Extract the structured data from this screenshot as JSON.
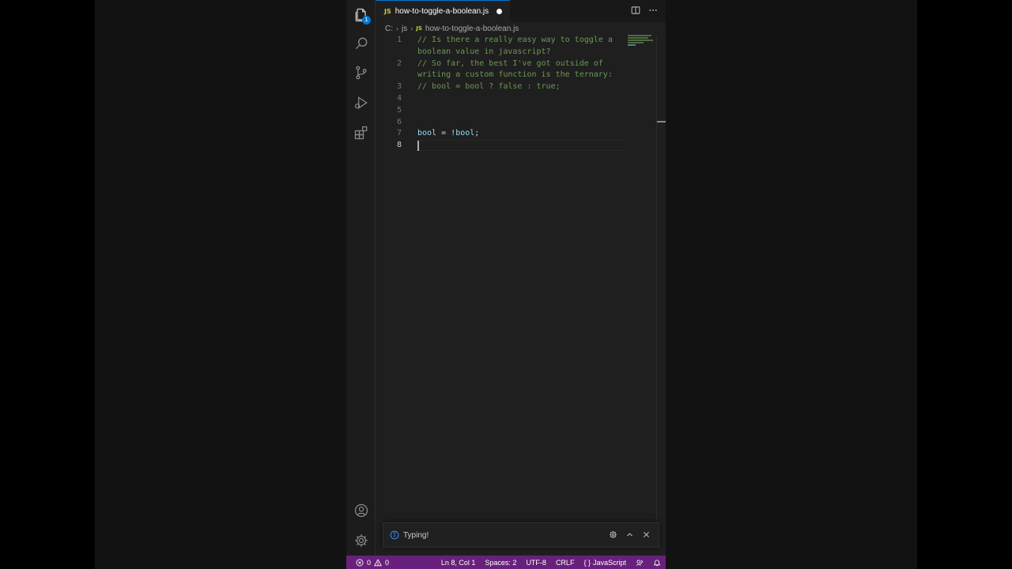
{
  "tab": {
    "language_badge": "JS",
    "title": "how-to-toggle-a-boolean.js"
  },
  "breadcrumb": {
    "drive": "C:",
    "folder": "js",
    "language_badge": "JS",
    "file": "how-to-toggle-a-boolean.js"
  },
  "activity_bar": {
    "explorer_badge": "1",
    "icons": [
      "files-icon",
      "search-icon",
      "source-control-icon",
      "run-debug-icon",
      "extensions-icon",
      "account-icon",
      "settings-gear-icon"
    ]
  },
  "editor": {
    "lines": [
      {
        "number": "1",
        "parts": [
          {
            "text": "// Is there a really easy way to toggle a",
            "class": "comment"
          }
        ]
      },
      {
        "number": "",
        "parts": [
          {
            "text": "boolean value in javascript?",
            "class": "comment"
          }
        ]
      },
      {
        "number": "2",
        "parts": [
          {
            "text": "// So far, the best I've got outside of",
            "class": "comment"
          }
        ]
      },
      {
        "number": "",
        "parts": [
          {
            "text": "writing a custom function is the ternary:",
            "class": "comment"
          }
        ]
      },
      {
        "number": "3",
        "parts": [
          {
            "text": "// bool = bool ? false : true;",
            "class": "comment"
          }
        ]
      },
      {
        "number": "4",
        "parts": []
      },
      {
        "number": "5",
        "parts": []
      },
      {
        "number": "6",
        "parts": []
      },
      {
        "number": "7",
        "parts": [
          {
            "text": "bool",
            "class": "var"
          },
          {
            "text": " = !",
            "class": "op"
          },
          {
            "text": "bool",
            "class": "var"
          },
          {
            "text": ";",
            "class": "op"
          }
        ]
      },
      {
        "number": "8",
        "parts": [],
        "active": true
      }
    ]
  },
  "notification": {
    "message": "Typing!"
  },
  "status_bar": {
    "errors": "0",
    "warnings": "0",
    "position": "Ln 8, Col 1",
    "indent": "Spaces: 2",
    "encoding": "UTF-8",
    "eol": "CRLF",
    "language": "JavaScript"
  },
  "colors": {
    "status_bar": "#68217a",
    "comment": "#6a9955",
    "variable": "#9cdcfe",
    "accent": "#0078d4"
  }
}
